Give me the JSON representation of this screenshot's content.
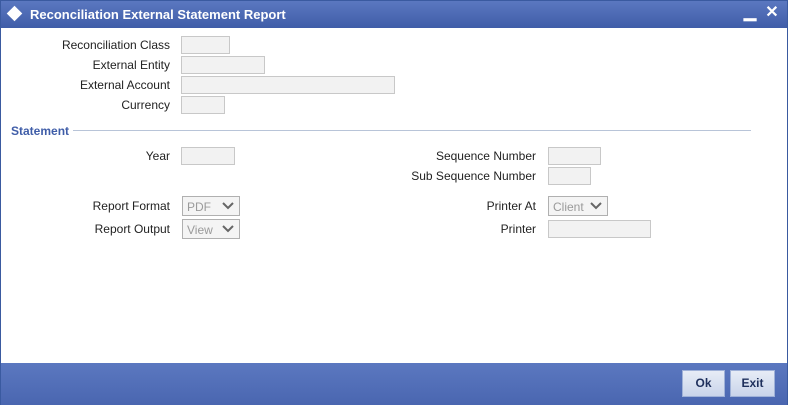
{
  "window": {
    "title": "Reconciliation External Statement Report",
    "minimize_glyph": "▁",
    "close_glyph": "✕"
  },
  "fields": {
    "reconciliation_class": {
      "label": "Reconciliation Class",
      "value": ""
    },
    "external_entity": {
      "label": "External Entity",
      "value": ""
    },
    "external_account": {
      "label": "External Account",
      "value": ""
    },
    "currency": {
      "label": "Currency",
      "value": ""
    }
  },
  "statement": {
    "section_title": "Statement",
    "year": {
      "label": "Year",
      "value": ""
    },
    "sequence_number": {
      "label": "Sequence Number",
      "value": ""
    },
    "sub_sequence_number": {
      "label": "Sub Sequence Number",
      "value": ""
    }
  },
  "report": {
    "format": {
      "label": "Report Format",
      "selected": "PDF"
    },
    "output": {
      "label": "Report Output",
      "selected": "View"
    },
    "printer_at": {
      "label": "Printer At",
      "selected": "Client"
    },
    "printer": {
      "label": "Printer",
      "value": ""
    }
  },
  "footer": {
    "ok_label": "Ok",
    "exit_label": "Exit"
  },
  "colors": {
    "titlebar": "#4a68b2",
    "section_title": "#3f5da8",
    "footer": "#4f6cb4"
  }
}
